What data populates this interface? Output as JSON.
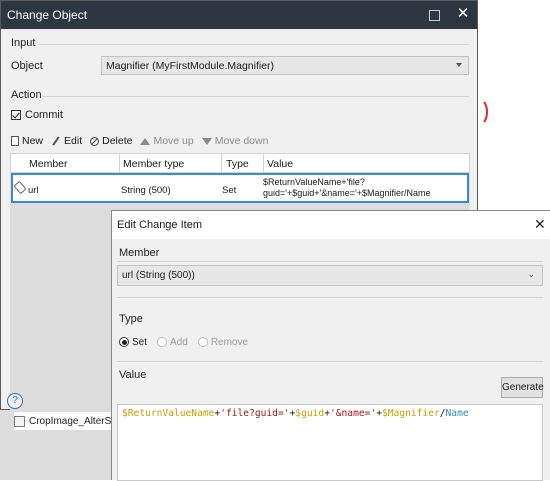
{
  "change_object": {
    "title": "Change Object",
    "input_section": "Input",
    "object_label": "Object",
    "object_value": "Magnifier (MyFirstModule.Magnifier)",
    "action_section": "Action",
    "commit_label": "Commit",
    "commit_checked": true,
    "toolbar": {
      "new": "New",
      "edit": "Edit",
      "delete": "Delete",
      "move_up": "Move up",
      "move_down": "Move down"
    },
    "columns": [
      "Member",
      "Member type",
      "Type",
      "Value"
    ],
    "rows": [
      {
        "member": "url",
        "member_type": "String (500)",
        "type": "Set",
        "value": "$ReturnValueName+'file?guid='+$guid+'&name='+$Magnifier/Name"
      }
    ]
  },
  "background": {
    "list_item": "CropImage_AlterSnippet"
  },
  "edit_change_item": {
    "title": "Edit Change Item",
    "member_section": "Member",
    "member_value": "url (String (500))",
    "type_section": "Type",
    "type_options": [
      {
        "label": "Set",
        "selected": true,
        "enabled": true
      },
      {
        "label": "Add",
        "selected": false,
        "enabled": false
      },
      {
        "label": "Remove",
        "selected": false,
        "enabled": false
      }
    ],
    "value_section": "Value",
    "generate_label": "Generate",
    "expression_parts": [
      {
        "text": "$ReturnValueName",
        "color": "#c8a000"
      },
      {
        "text": "+",
        "color": "#1a1a1a"
      },
      {
        "text": "'file?guid='",
        "color": "#a31515"
      },
      {
        "text": "+",
        "color": "#1a1a1a"
      },
      {
        "text": "$guid",
        "color": "#c8a000"
      },
      {
        "text": "+",
        "color": "#1a1a1a"
      },
      {
        "text": "'&name='",
        "color": "#a31515"
      },
      {
        "text": "+",
        "color": "#1a1a1a"
      },
      {
        "text": "$Magnifier",
        "color": "#c8a000"
      },
      {
        "text": "/",
        "color": "#1a1a1a"
      },
      {
        "text": "Name",
        "color": "#2b91af"
      }
    ]
  },
  "colors": {
    "titlebar": "#2e3642",
    "selection": "#3a8ad3",
    "variable": "#c8a000",
    "string": "#a31515",
    "attribute": "#2b91af"
  }
}
